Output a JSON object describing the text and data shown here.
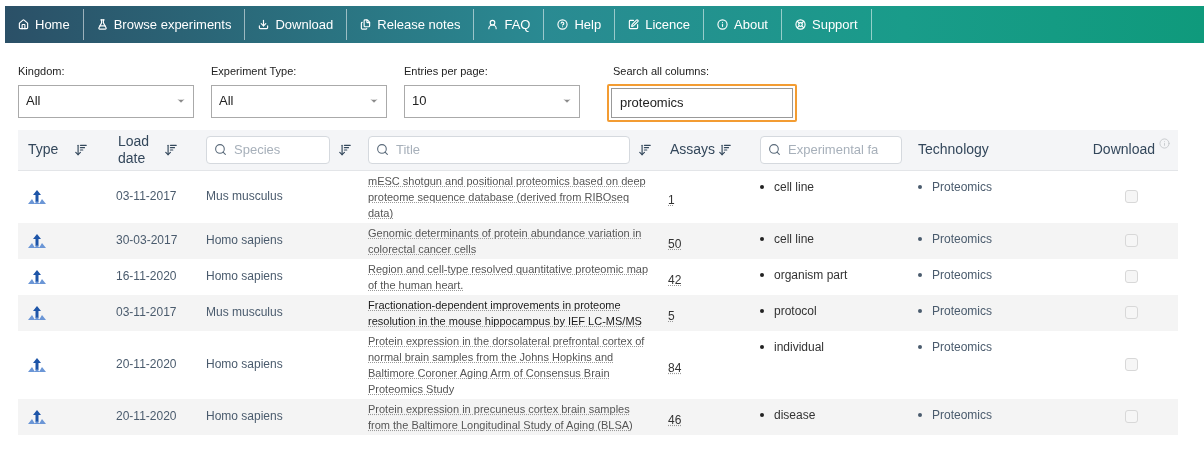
{
  "nav": [
    {
      "label": "Home"
    },
    {
      "label": "Browse experiments"
    },
    {
      "label": "Download"
    },
    {
      "label": "Release notes"
    },
    {
      "label": "FAQ"
    },
    {
      "label": "Help"
    },
    {
      "label": "Licence"
    },
    {
      "label": "About"
    },
    {
      "label": "Support"
    }
  ],
  "filters": [
    {
      "label": "Kingdom:",
      "value": "All"
    },
    {
      "label": "Experiment Type:",
      "value": "All"
    },
    {
      "label": "Entries per page:",
      "value": "10"
    }
  ],
  "search": {
    "label": "Search all columns:",
    "value": "proteomics"
  },
  "table": {
    "columns": [
      {
        "kind": "sort",
        "label": "Type"
      },
      {
        "kind": "sort",
        "label": "Load date"
      },
      {
        "kind": "filter-sort",
        "placeholder": "Species"
      },
      {
        "kind": "filter-sort",
        "placeholder": "Title"
      },
      {
        "kind": "sort",
        "label": "Assays"
      },
      {
        "kind": "filter",
        "placeholder": "Experimental fa"
      },
      {
        "kind": "plain",
        "label": "Technology"
      },
      {
        "kind": "info",
        "label": "Download"
      }
    ],
    "rows": [
      {
        "date": "03-11-2017",
        "species": "Mus musculus",
        "title": "mESC shotgun and positional proteomics based on deep proteome sequence database (derived from RIBOseq data)",
        "assays": "1",
        "factor": "cell line",
        "technology": "Proteomics",
        "hovered": false,
        "checked": false
      },
      {
        "date": "30-03-2017",
        "species": "Homo sapiens",
        "title": "Genomic determinants of protein abundance variation in colorectal cancer cells",
        "assays": "50",
        "factor": "cell line",
        "technology": "Proteomics",
        "hovered": false,
        "checked": false
      },
      {
        "date": "16-11-2020",
        "species": "Homo sapiens",
        "title": "Region and cell-type resolved quantitative proteomic map of the human heart.",
        "assays": "42",
        "factor": "organism part",
        "technology": "Proteomics",
        "hovered": false,
        "checked": false
      },
      {
        "date": "03-11-2017",
        "species": "Mus musculus",
        "title": "Fractionation-dependent improvements in proteome resolution in the mouse hippocampus by IEF LC-MS/MS",
        "assays": "5",
        "factor": "protocol",
        "technology": "Proteomics",
        "hovered": true,
        "checked": false
      },
      {
        "date": "20-11-2020",
        "species": "Homo sapiens",
        "title": "Protein expression in the dorsolateral prefrontal cortex of normal brain samples from the Johns Hopkins and Baltimore Coroner Aging Arm of Consensus Brain Proteomics Study",
        "assays": "84",
        "factor": "individual",
        "technology": "Proteomics",
        "hovered": false,
        "checked": false
      },
      {
        "date": "20-11-2020",
        "species": "Homo sapiens",
        "title": "Protein expression in precuneus cortex brain samples from the Baltimore Longitudinal Study of Aging (BLSA)",
        "assays": "46",
        "factor": "disease",
        "technology": "Proteomics",
        "hovered": false,
        "checked": false
      }
    ]
  }
}
